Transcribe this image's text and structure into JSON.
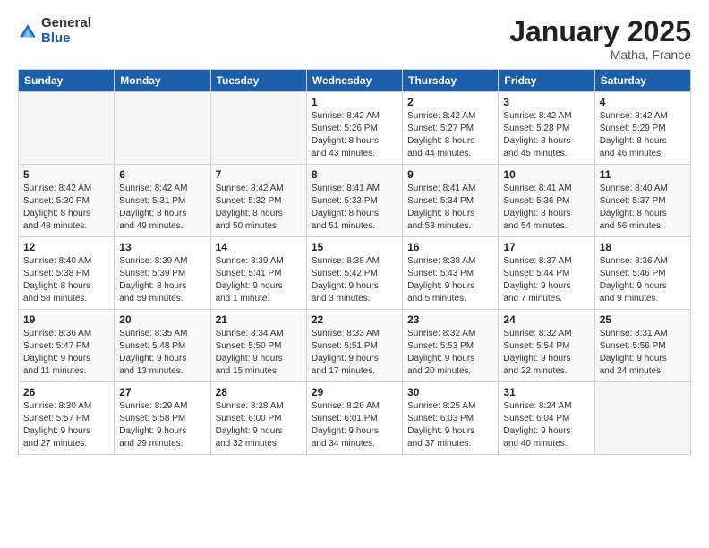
{
  "logo": {
    "general": "General",
    "blue": "Blue"
  },
  "title": {
    "month_year": "January 2025",
    "location": "Matha, France"
  },
  "weekdays": [
    "Sunday",
    "Monday",
    "Tuesday",
    "Wednesday",
    "Thursday",
    "Friday",
    "Saturday"
  ],
  "weeks": [
    [
      {
        "day": "",
        "text": ""
      },
      {
        "day": "",
        "text": ""
      },
      {
        "day": "",
        "text": ""
      },
      {
        "day": "1",
        "text": "Sunrise: 8:42 AM\nSunset: 5:26 PM\nDaylight: 8 hours\nand 43 minutes."
      },
      {
        "day": "2",
        "text": "Sunrise: 8:42 AM\nSunset: 5:27 PM\nDaylight: 8 hours\nand 44 minutes."
      },
      {
        "day": "3",
        "text": "Sunrise: 8:42 AM\nSunset: 5:28 PM\nDaylight: 8 hours\nand 45 minutes."
      },
      {
        "day": "4",
        "text": "Sunrise: 8:42 AM\nSunset: 5:29 PM\nDaylight: 8 hours\nand 46 minutes."
      }
    ],
    [
      {
        "day": "5",
        "text": "Sunrise: 8:42 AM\nSunset: 5:30 PM\nDaylight: 8 hours\nand 48 minutes."
      },
      {
        "day": "6",
        "text": "Sunrise: 8:42 AM\nSunset: 5:31 PM\nDaylight: 8 hours\nand 49 minutes."
      },
      {
        "day": "7",
        "text": "Sunrise: 8:42 AM\nSunset: 5:32 PM\nDaylight: 8 hours\nand 50 minutes."
      },
      {
        "day": "8",
        "text": "Sunrise: 8:41 AM\nSunset: 5:33 PM\nDaylight: 8 hours\nand 51 minutes."
      },
      {
        "day": "9",
        "text": "Sunrise: 8:41 AM\nSunset: 5:34 PM\nDaylight: 8 hours\nand 53 minutes."
      },
      {
        "day": "10",
        "text": "Sunrise: 8:41 AM\nSunset: 5:36 PM\nDaylight: 8 hours\nand 54 minutes."
      },
      {
        "day": "11",
        "text": "Sunrise: 8:40 AM\nSunset: 5:37 PM\nDaylight: 8 hours\nand 56 minutes."
      }
    ],
    [
      {
        "day": "12",
        "text": "Sunrise: 8:40 AM\nSunset: 5:38 PM\nDaylight: 8 hours\nand 58 minutes."
      },
      {
        "day": "13",
        "text": "Sunrise: 8:39 AM\nSunset: 5:39 PM\nDaylight: 8 hours\nand 59 minutes."
      },
      {
        "day": "14",
        "text": "Sunrise: 8:39 AM\nSunset: 5:41 PM\nDaylight: 9 hours\nand 1 minute."
      },
      {
        "day": "15",
        "text": "Sunrise: 8:38 AM\nSunset: 5:42 PM\nDaylight: 9 hours\nand 3 minutes."
      },
      {
        "day": "16",
        "text": "Sunrise: 8:38 AM\nSunset: 5:43 PM\nDaylight: 9 hours\nand 5 minutes."
      },
      {
        "day": "17",
        "text": "Sunrise: 8:37 AM\nSunset: 5:44 PM\nDaylight: 9 hours\nand 7 minutes."
      },
      {
        "day": "18",
        "text": "Sunrise: 8:36 AM\nSunset: 5:46 PM\nDaylight: 9 hours\nand 9 minutes."
      }
    ],
    [
      {
        "day": "19",
        "text": "Sunrise: 8:36 AM\nSunset: 5:47 PM\nDaylight: 9 hours\nand 11 minutes."
      },
      {
        "day": "20",
        "text": "Sunrise: 8:35 AM\nSunset: 5:48 PM\nDaylight: 9 hours\nand 13 minutes."
      },
      {
        "day": "21",
        "text": "Sunrise: 8:34 AM\nSunset: 5:50 PM\nDaylight: 9 hours\nand 15 minutes."
      },
      {
        "day": "22",
        "text": "Sunrise: 8:33 AM\nSunset: 5:51 PM\nDaylight: 9 hours\nand 17 minutes."
      },
      {
        "day": "23",
        "text": "Sunrise: 8:32 AM\nSunset: 5:53 PM\nDaylight: 9 hours\nand 20 minutes."
      },
      {
        "day": "24",
        "text": "Sunrise: 8:32 AM\nSunset: 5:54 PM\nDaylight: 9 hours\nand 22 minutes."
      },
      {
        "day": "25",
        "text": "Sunrise: 8:31 AM\nSunset: 5:56 PM\nDaylight: 9 hours\nand 24 minutes."
      }
    ],
    [
      {
        "day": "26",
        "text": "Sunrise: 8:30 AM\nSunset: 5:57 PM\nDaylight: 9 hours\nand 27 minutes."
      },
      {
        "day": "27",
        "text": "Sunrise: 8:29 AM\nSunset: 5:58 PM\nDaylight: 9 hours\nand 29 minutes."
      },
      {
        "day": "28",
        "text": "Sunrise: 8:28 AM\nSunset: 6:00 PM\nDaylight: 9 hours\nand 32 minutes."
      },
      {
        "day": "29",
        "text": "Sunrise: 8:26 AM\nSunset: 6:01 PM\nDaylight: 9 hours\nand 34 minutes."
      },
      {
        "day": "30",
        "text": "Sunrise: 8:25 AM\nSunset: 6:03 PM\nDaylight: 9 hours\nand 37 minutes."
      },
      {
        "day": "31",
        "text": "Sunrise: 8:24 AM\nSunset: 6:04 PM\nDaylight: 9 hours\nand 40 minutes."
      },
      {
        "day": "",
        "text": ""
      }
    ]
  ]
}
